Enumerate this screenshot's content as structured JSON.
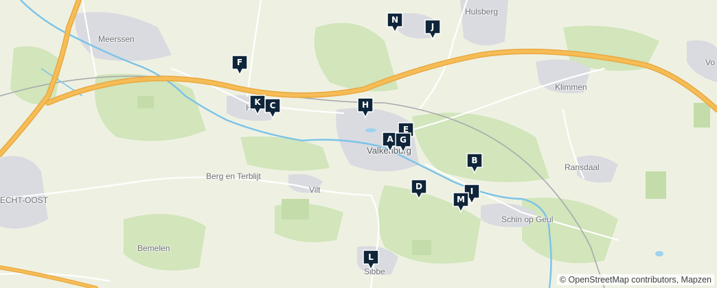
{
  "map": {
    "places": {
      "meerssen": "Meerssen",
      "hulsberg": "Hulsberg",
      "klimmen": "Klimmen",
      "ransdaal": "Ransdaal",
      "valkenburg": "Valkenburg",
      "berg_en_terblijt": "Berg en Terblijt",
      "vilt": "Vilt",
      "schin_op_geul": "Schin op Geul",
      "bemelen": "Bemelen",
      "sibbe": "Sibbe",
      "maastricht_oost": "ECHT-OOST",
      "houthem": "H",
      "vo": "Vo"
    },
    "markers": {
      "a": "A",
      "b": "B",
      "c": "C",
      "d": "D",
      "e": "E",
      "f": "F",
      "g": "G",
      "h": "H",
      "i": "I",
      "j": "J",
      "k": "K",
      "l": "L",
      "m": "M",
      "n": "N"
    },
    "colors": {
      "marker": "#0f2539",
      "motorway": "#f4b54a",
      "river": "#7bc3e8",
      "urban": "#d9dbe0",
      "forest": "#cfe3b8"
    },
    "attribution": "© OpenStreetMap contributors, Mapzen"
  }
}
